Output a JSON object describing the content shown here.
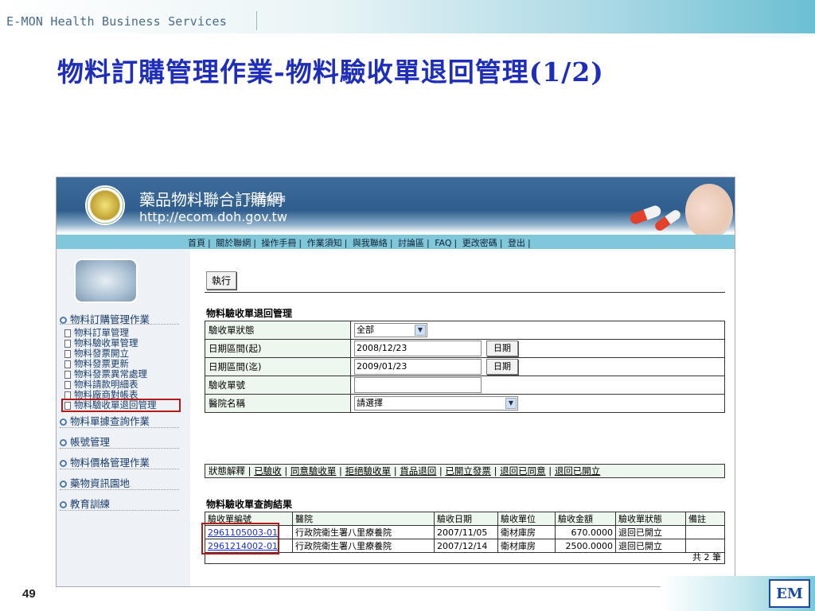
{
  "slide": {
    "org": "E-MON Health Business Services",
    "title": "物料訂購管理作業-物料驗收單退回管理(1/2)",
    "page_number": "49",
    "logo_text": "EM"
  },
  "site": {
    "name": "藥品物料聯合訂購網",
    "subname": "行政院衛生署",
    "url": "http://ecom.doh.gov.tw",
    "nav": [
      "首頁",
      "關於聯網",
      "操作手冊",
      "作業須知",
      "與我聯絡",
      "討論區",
      "FAQ",
      "更改密碼",
      "登出"
    ]
  },
  "sidebar": {
    "group1": "物料訂購管理作業",
    "sub_items": [
      "物料訂單管理",
      "物料驗收單管理",
      "物料發票開立",
      "物料發票更新",
      "物料發票異常處理",
      "物料請款明細表",
      "物料廠商對帳表",
      "物料驗收單退回管理"
    ],
    "groups": [
      "物料單據查詢作業",
      "帳號管理",
      "物料價格管理作業",
      "藥物資訊園地",
      "教育訓練"
    ]
  },
  "content": {
    "execute_button": "執行",
    "form_title": "物料驗收單退回管理",
    "fields": {
      "status_label": "驗收單狀態",
      "status_value": "全部",
      "date_from_label": "日期區間(起)",
      "date_from_value": "2008/12/23",
      "date_to_label": "日期區間(迄)",
      "date_to_value": "2009/01/23",
      "date_button": "日期",
      "receipt_no_label": "驗收單號",
      "receipt_no_value": "",
      "hospital_label": "醫院名稱",
      "hospital_value": "請選擇"
    },
    "legend": {
      "label": "狀態解釋",
      "items": [
        "已驗收",
        "同意驗收單",
        "拒絕驗收單",
        "貨品退回",
        "已開立發票",
        "退回已同意",
        "退回已開立"
      ]
    },
    "results_title": "物料驗收單查詢結果",
    "results": {
      "headers": [
        "驗收單編號",
        "醫院",
        "驗收日期",
        "驗收單位",
        "驗收金額",
        "驗收單狀態",
        "備註"
      ],
      "rows": [
        [
          "2961105003-01",
          "行政院衛生署八里療養院",
          "2007/11/05",
          "衛材庫房",
          "670.0000",
          "退回已開立",
          ""
        ],
        [
          "2961214002-01",
          "行政院衛生署八里療養院",
          "2007/12/14",
          "衛材庫房",
          "2500.0000",
          "退回已開立",
          ""
        ]
      ],
      "total": "共 2 筆"
    }
  },
  "colors": {
    "title": "#1f2eb8",
    "highlight_box": "#b81818",
    "link": "#1b2fcf",
    "form_label_bg": "#eef7ee",
    "navbar": "#80c7dc"
  }
}
